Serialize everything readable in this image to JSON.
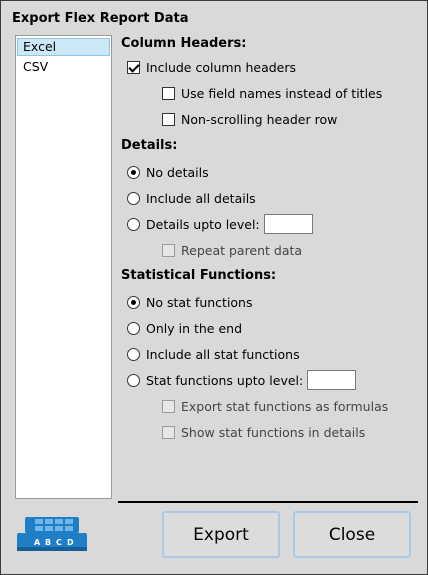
{
  "dialog": {
    "title": "Export Flex Report Data"
  },
  "formats": [
    "Excel",
    "CSV"
  ],
  "column_headers": {
    "heading": "Column Headers:",
    "include_headers": "Include column headers",
    "use_field_names": "Use field names instead of titles",
    "non_scrolling": "Non-scrolling header row"
  },
  "details": {
    "heading": "Details:",
    "no_details": "No details",
    "include_all": "Include all details",
    "upto_level": "Details upto level:",
    "upto_level_value": "",
    "repeat_parent": "Repeat parent data"
  },
  "stat_functions": {
    "heading": "Statistical Functions:",
    "none": "No stat functions",
    "only_end": "Only in the end",
    "include_all": "Include all stat functions",
    "upto_level": "Stat functions upto level:",
    "upto_level_value": "",
    "as_formulas": "Export stat functions as formulas",
    "in_details": "Show stat functions in details"
  },
  "logo": {
    "letters": [
      "A",
      "B",
      "C",
      "D"
    ],
    "color": "#1f7fc6"
  },
  "buttons": {
    "export": "Export",
    "close": "Close"
  }
}
